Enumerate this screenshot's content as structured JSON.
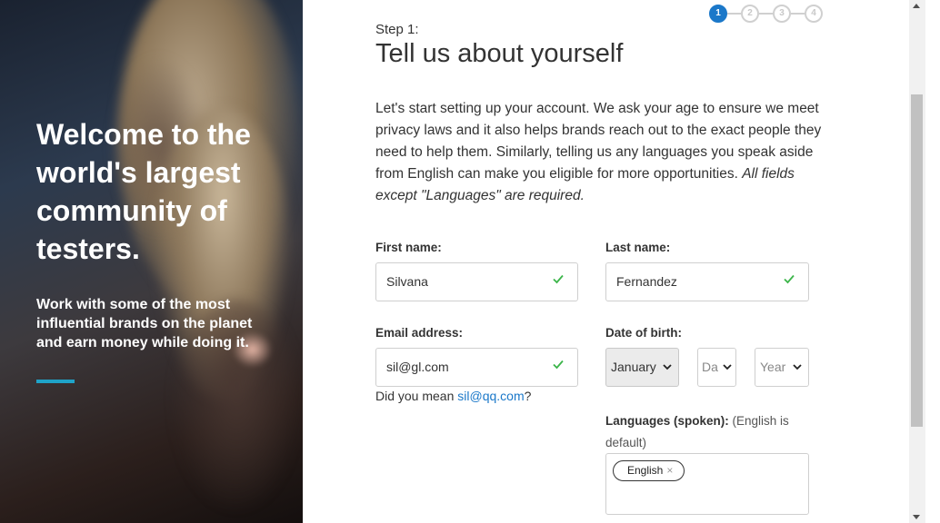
{
  "hero": {
    "title": "Welcome to the world's largest community of testers.",
    "subtitle": "Work with some of the most influential brands on the planet and earn money while doing it.",
    "accent_color": "#1fa3c8"
  },
  "stepper": {
    "steps": [
      "1",
      "2",
      "3",
      "4"
    ],
    "active": 1,
    "active_color": "#1b78c9"
  },
  "form": {
    "step_label": "Step 1:",
    "title": "Tell us about yourself",
    "intro": "Let's start setting up your account. We ask your age to ensure we meet privacy laws and it also helps brands reach out to the exact people they need to help them. Similarly, telling us any languages you speak aside from English can make you eligible for more opportunities.",
    "intro_emphasis": "All fields except \"Languages\" are required.",
    "first_name": {
      "label": "First name:",
      "value": "Silvana",
      "valid_icon": "check-icon"
    },
    "last_name": {
      "label": "Last name:",
      "value": "Fernandez",
      "valid_icon": "check-icon"
    },
    "email": {
      "label": "Email address:",
      "value": "sil@gl.com",
      "valid_icon": "check-icon"
    },
    "suggestion": {
      "prefix": "Did you mean ",
      "link": "sil@qq.com",
      "suffix": "?"
    },
    "dob": {
      "label": "Date of birth:",
      "month": "January",
      "day_placeholder": "Day",
      "year_placeholder": "Year"
    },
    "languages": {
      "label": "Languages (spoken):",
      "note": " (English is default)",
      "chips": [
        "English"
      ]
    },
    "valid_color": "#3cb54a"
  }
}
